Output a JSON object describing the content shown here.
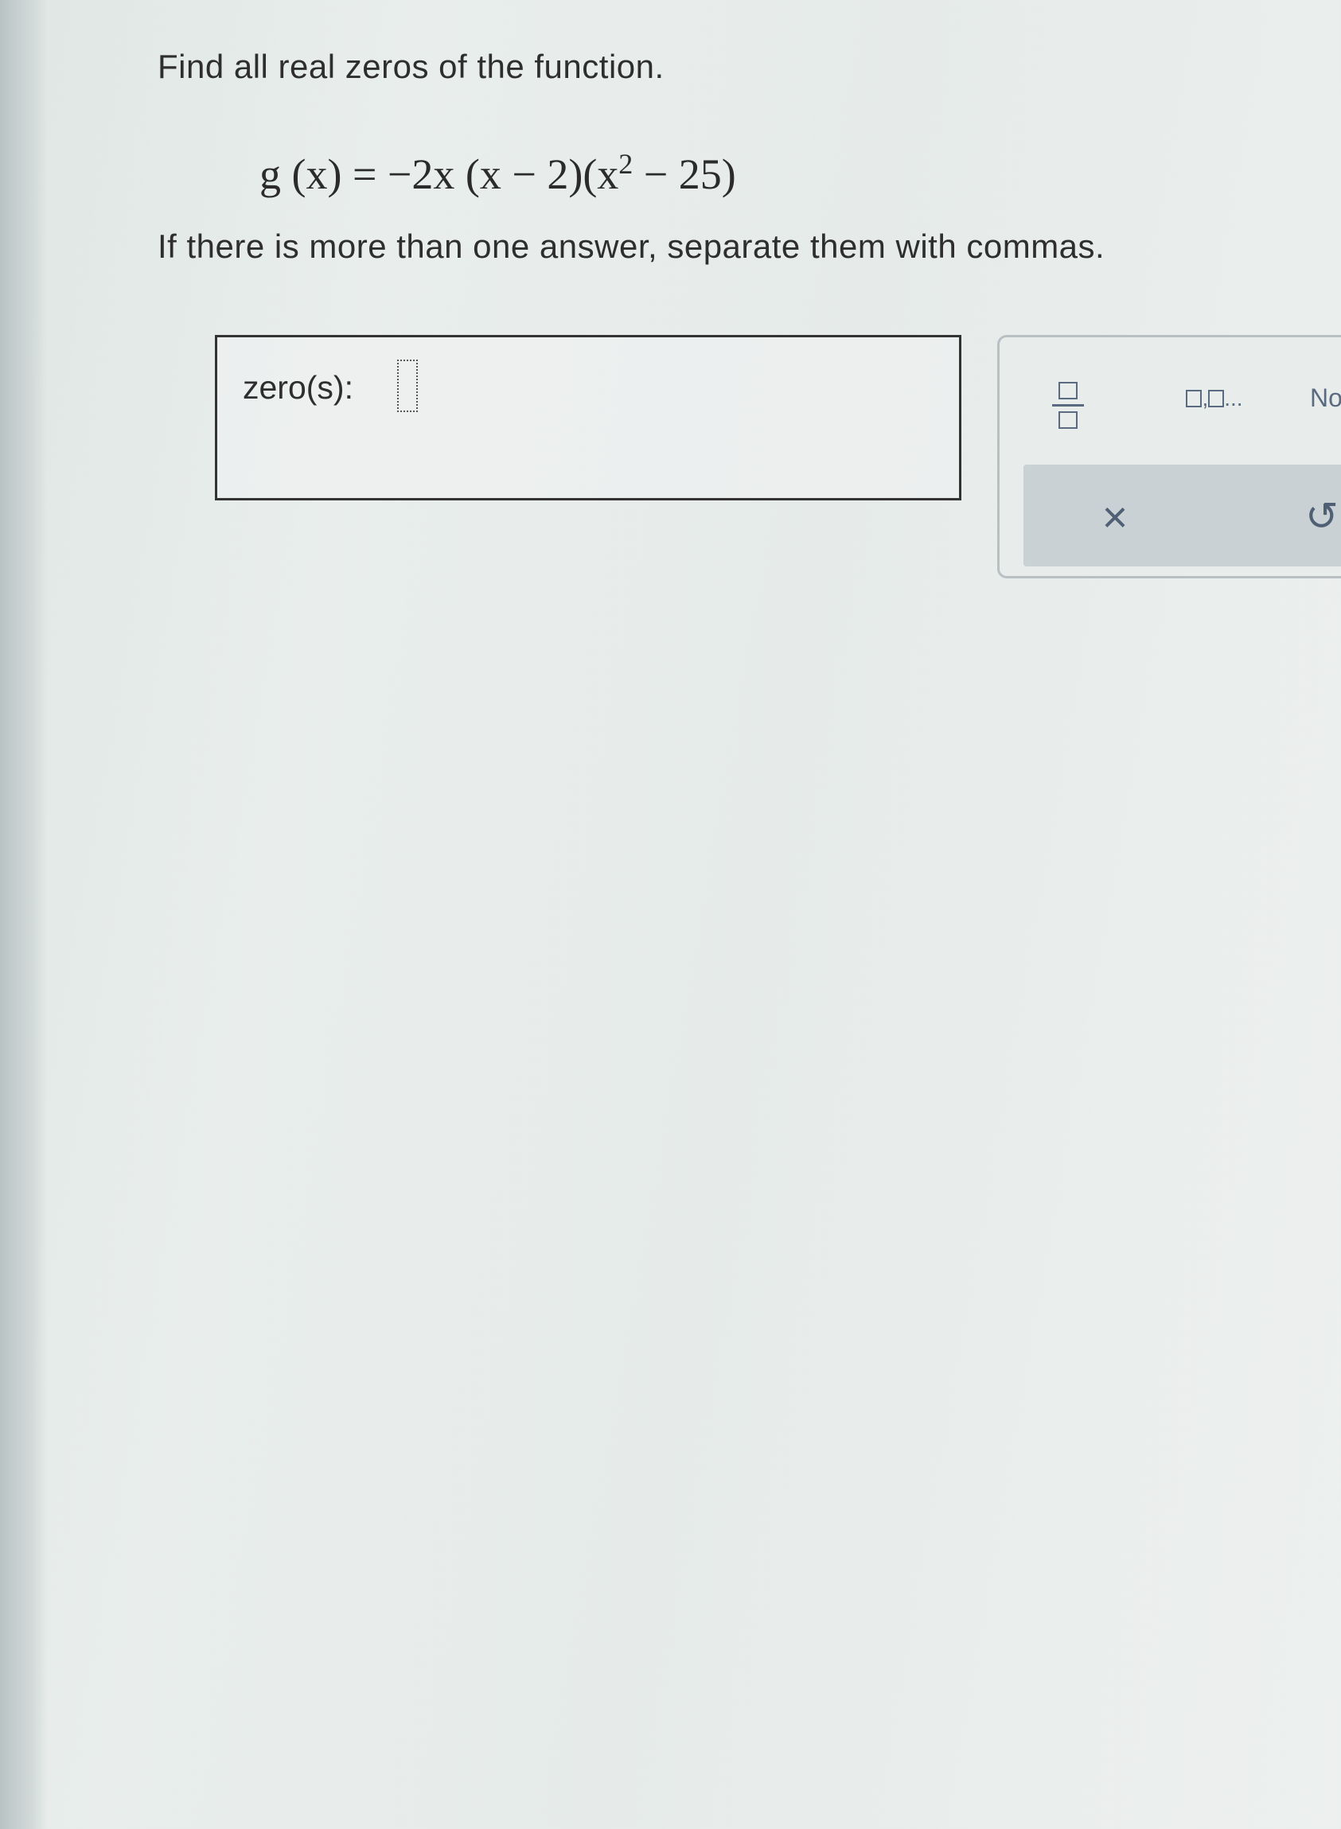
{
  "question": {
    "prompt": "Find all real zeros of the function.",
    "equation": {
      "lhs": "g (x) = ",
      "factor_1": "−2x",
      "factor_2": " (x − 2)",
      "factor_3_open": "(x",
      "exponent": "2",
      "factor_3_close": " − 25)"
    },
    "instructions": "If there is more than one answer, separate them with commas."
  },
  "answer": {
    "label": "zero(s):",
    "value": ""
  },
  "keypad": {
    "fraction_icon": "fraction-icon",
    "list_label": ",",
    "list_ellipsis": "...",
    "none_label": "No",
    "clear_glyph": "×",
    "undo_glyph": "↺"
  }
}
